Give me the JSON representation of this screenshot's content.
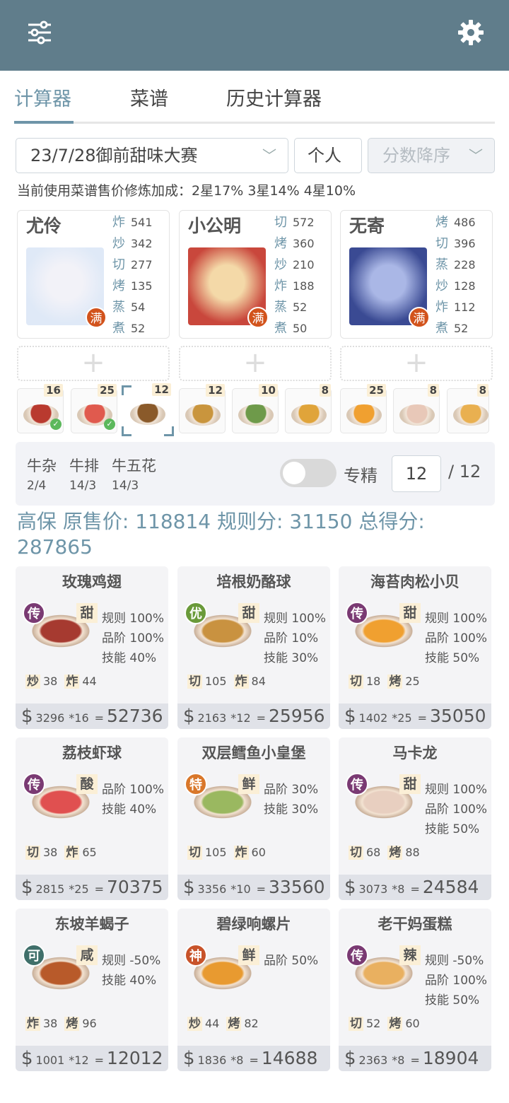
{
  "colors": {
    "header": "#607d8b",
    "accent": "#6e95a8",
    "man": "#d2531c"
  },
  "header": {
    "left_icon": "sliders-icon",
    "right_icon": "gear-icon"
  },
  "tabs": [
    "计算器",
    "菜谱",
    "历史计算器"
  ],
  "filters": {
    "contest": "23/7/28御前甜味大赛",
    "mode": "个人",
    "sort": "分数降序"
  },
  "note": "当前使用菜谱售价修炼加成：2星17% 3星14% 4星10%",
  "chefs": [
    {
      "name": "尤伶",
      "badge": "满",
      "skills": [
        {
          "k": "炸",
          "v": "541"
        },
        {
          "k": "炒",
          "v": "342"
        },
        {
          "k": "切",
          "v": "277"
        },
        {
          "k": "烤",
          "v": "135"
        },
        {
          "k": "蒸",
          "v": "54"
        },
        {
          "k": "煮",
          "v": "52"
        }
      ]
    },
    {
      "name": "小公明",
      "badge": "满",
      "skills": [
        {
          "k": "切",
          "v": "572"
        },
        {
          "k": "烤",
          "v": "360"
        },
        {
          "k": "炒",
          "v": "210"
        },
        {
          "k": "炸",
          "v": "188"
        },
        {
          "k": "蒸",
          "v": "52"
        },
        {
          "k": "煮",
          "v": "50"
        }
      ]
    },
    {
      "name": "无寄",
      "badge": "满",
      "skills": [
        {
          "k": "烤",
          "v": "486"
        },
        {
          "k": "切",
          "v": "396"
        },
        {
          "k": "蒸",
          "v": "228"
        },
        {
          "k": "炒",
          "v": "128"
        },
        {
          "k": "炸",
          "v": "112"
        },
        {
          "k": "煮",
          "v": "52"
        }
      ]
    }
  ],
  "add_symbol": "+",
  "thumbs": [
    "16",
    "25",
    "12",
    "12",
    "10",
    "8",
    "25",
    "8",
    "8"
  ],
  "materials": [
    {
      "name": "牛杂",
      "count": "2/4"
    },
    {
      "name": "牛排",
      "count": "14/3"
    },
    {
      "name": "牛五花",
      "count": "14/3"
    }
  ],
  "specialize": {
    "label": "专精",
    "value": "12",
    "max": "/ 12",
    "enabled": false
  },
  "summary": "高保 原售价: 118814 规则分: 31150 总得分: 287865",
  "dishes": [
    {
      "title": "玫瑰鸡翅",
      "grade": "传",
      "taste": "甜",
      "stats": [
        "规则 100%",
        "品阶 100%",
        "技能 40%"
      ],
      "req": [
        {
          "k": "炒",
          "v": "38"
        },
        {
          "k": "炸",
          "v": "44"
        }
      ],
      "price": "3296",
      "mult": "*16",
      "total": "52736"
    },
    {
      "title": "培根奶酪球",
      "grade": "优",
      "taste": "甜",
      "stats": [
        "规则 100%",
        "品阶 10%",
        "技能 30%"
      ],
      "req": [
        {
          "k": "切",
          "v": "105"
        },
        {
          "k": "炸",
          "v": "84"
        }
      ],
      "price": "2163",
      "mult": "*12",
      "total": "25956"
    },
    {
      "title": "海苔肉松小贝",
      "grade": "传",
      "taste": "甜",
      "stats": [
        "规则 100%",
        "品阶 100%",
        "技能 50%"
      ],
      "req": [
        {
          "k": "切",
          "v": "18"
        },
        {
          "k": "烤",
          "v": "25"
        }
      ],
      "price": "1402",
      "mult": "*25",
      "total": "35050"
    },
    {
      "title": "荔枝虾球",
      "grade": "传",
      "taste": "酸",
      "stats": [
        "品阶 100%",
        "技能 40%"
      ],
      "req": [
        {
          "k": "切",
          "v": "38"
        },
        {
          "k": "炸",
          "v": "65"
        }
      ],
      "price": "2815",
      "mult": "*25",
      "total": "70375"
    },
    {
      "title": "双层鳕鱼小皇堡",
      "grade": "特",
      "taste": "鲜",
      "stats": [
        "品阶 30%",
        "技能 30%"
      ],
      "req": [
        {
          "k": "切",
          "v": "105"
        },
        {
          "k": "炸",
          "v": "60"
        }
      ],
      "price": "3356",
      "mult": "*10",
      "total": "33560"
    },
    {
      "title": "马卡龙",
      "grade": "传",
      "taste": "甜",
      "stats": [
        "规则 100%",
        "品阶 100%",
        "技能 50%"
      ],
      "req": [
        {
          "k": "切",
          "v": "68"
        },
        {
          "k": "烤",
          "v": "88"
        }
      ],
      "price": "3073",
      "mult": "*8",
      "total": "24584"
    },
    {
      "title": "东坡羊蝎子",
      "grade": "可",
      "taste": "咸",
      "stats": [
        "规则 -50%",
        "技能 40%"
      ],
      "req": [
        {
          "k": "炸",
          "v": "38"
        },
        {
          "k": "烤",
          "v": "96"
        }
      ],
      "price": "1001",
      "mult": "*12",
      "total": "12012"
    },
    {
      "title": "碧绿响螺片",
      "grade": "神",
      "taste": "鲜",
      "stats": [
        "品阶 50%"
      ],
      "req": [
        {
          "k": "炒",
          "v": "44"
        },
        {
          "k": "烤",
          "v": "82"
        }
      ],
      "price": "1836",
      "mult": "*8",
      "total": "14688"
    },
    {
      "title": "老干妈蛋糕",
      "grade": "传",
      "taste": "辣",
      "stats": [
        "规则 -50%",
        "品阶 100%",
        "技能 50%"
      ],
      "req": [
        {
          "k": "切",
          "v": "52"
        },
        {
          "k": "烤",
          "v": "60"
        }
      ],
      "price": "2363",
      "mult": "*8",
      "total": "18904"
    }
  ]
}
